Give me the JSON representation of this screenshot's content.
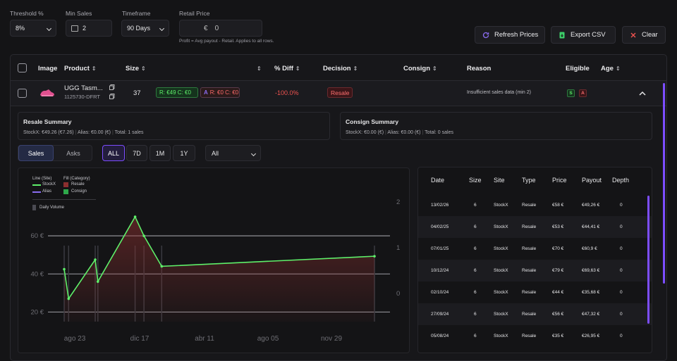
{
  "filters": {
    "threshold_label": "Threshold %",
    "threshold_value": "8%",
    "minsales_label": "Min Sales",
    "minsales_value": "2",
    "timeframe_label": "Timeframe",
    "timeframe_value": "90 Days",
    "retail_label": "Retail Price",
    "retail_currency": "€",
    "retail_value": "0",
    "note": "Profit = Avg payout - Retail. Applies to all rows."
  },
  "actions": {
    "refresh": "Refresh Prices",
    "export": "Export CSV",
    "clear": "Clear"
  },
  "table": {
    "headers": {
      "image": "Image",
      "product": "Product",
      "size": "Size",
      "diff": "% Diff",
      "decision": "Decision",
      "consign": "Consign",
      "reason": "Reason",
      "eligible": "Eligible",
      "age": "Age"
    },
    "row": {
      "name": "UGG Tasm...",
      "sku": "1125730-DFRT",
      "size": "37",
      "stockx_pill": "R: €49 C: €0",
      "alias_pill_letter": "A",
      "alias_pill": "R: €0 C: €0",
      "diff": "-100.0%",
      "decision": "Resale",
      "reason": "Insufficient sales data (min 2)",
      "elig_s": "S",
      "elig_a": "A"
    }
  },
  "summary": {
    "resale_title": "Resale Summary",
    "resale_stockx": "StockX: €49.26 (€7.26)",
    "resale_alias": "Alias: €0.00 (€)",
    "resale_total": "Total: 1 sales",
    "consign_title": "Consign Summary",
    "consign_stockx": "StockX: €0.00 (€)",
    "consign_alias": "Alias: €0.00 (€)",
    "consign_total": "Total: 0 sales"
  },
  "tabs": {
    "sales": "Sales",
    "asks": "Asks"
  },
  "ranges": {
    "all": "ALL",
    "d7": "7D",
    "m1": "1M",
    "y1": "1Y",
    "filter": "All"
  },
  "legend": {
    "line_title": "Line (Site)",
    "fill_title": "Fill (Category)",
    "stockx": "StockX",
    "alias": "Alias",
    "resale": "Resale",
    "consign": "Consign",
    "volume": "Daily Volume"
  },
  "colors": {
    "stockx": "#5ef06a",
    "alias": "#8a6cf0",
    "resale": "#8b2f2f",
    "consign": "#2ea84a",
    "accent": "#7c4dff"
  },
  "chart_data": {
    "type": "line",
    "series": [
      {
        "name": "StockX",
        "values": [
          {
            "x": 0.0,
            "y": 42.5
          },
          {
            "x": 0.5,
            "y": 27
          },
          {
            "x": 3.5,
            "y": 47.5
          },
          {
            "x": 3.8,
            "y": 36
          },
          {
            "x": 8.0,
            "y": 70
          },
          {
            "x": 9.0,
            "y": 60
          },
          {
            "x": 11.0,
            "y": 44
          },
          {
            "x": 35.0,
            "y": 49.3
          }
        ]
      }
    ],
    "xticks": [
      "ago 23",
      "dic 17",
      "abr 11",
      "ago 05",
      "nov 29"
    ],
    "yticks": [
      "20 €",
      "40 €",
      "60 €"
    ],
    "ylim": [
      15,
      80
    ],
    "y2ticks": [
      "0",
      "1",
      "2"
    ]
  },
  "sales": {
    "headers": [
      "Date",
      "Size",
      "Site",
      "Type",
      "Price",
      "Payout",
      "Depth"
    ],
    "rows": [
      [
        "13/02/26",
        "6",
        "StockX",
        "Resale",
        "€58 €",
        "€49,26 €",
        "0"
      ],
      [
        "04/02/25",
        "6",
        "StockX",
        "Resale",
        "€53 €",
        "€44,41 €",
        "0"
      ],
      [
        "07/01/25",
        "6",
        "StockX",
        "Resale",
        "€70 €",
        "€60,9 €",
        "0"
      ],
      [
        "10/12/24",
        "6",
        "StockX",
        "Resale",
        "€79 €",
        "€69,63 €",
        "0"
      ],
      [
        "02/10/24",
        "6",
        "StockX",
        "Resale",
        "€44 €",
        "€35,68 €",
        "0"
      ],
      [
        "27/09/24",
        "6",
        "StockX",
        "Resale",
        "€56 €",
        "€47,32 €",
        "0"
      ],
      [
        "05/08/24",
        "6",
        "StockX",
        "Resale",
        "€35 €",
        "€26,95 €",
        "0"
      ]
    ]
  }
}
